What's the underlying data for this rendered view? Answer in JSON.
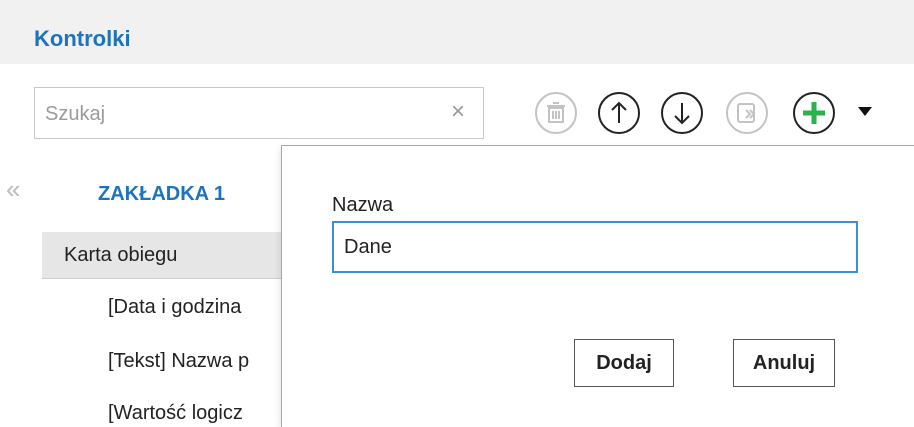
{
  "header": {
    "title": "Kontrolki"
  },
  "search": {
    "placeholder": "Szukaj",
    "value": "",
    "clear_glyph": "×"
  },
  "toolbar": {
    "icons": [
      "trash-icon",
      "arrow-up-icon",
      "arrow-down-icon",
      "move-to-icon",
      "plus-icon",
      "caret-down-icon"
    ],
    "colors": {
      "disabled": "#c3c3c3",
      "enabled": "#222222",
      "add": "#2bb24c"
    }
  },
  "left_panel": {
    "collapse_glyph": "«",
    "tab": "ZAKŁADKA 1",
    "section": "Karta obiegu",
    "items": [
      "[Data i godzina",
      "[Tekst] Nazwa p",
      "[Wartość logicz"
    ]
  },
  "dialog": {
    "field_label": "Nazwa",
    "field_value": "Dane",
    "add_button": "Dodaj",
    "cancel_button": "Anuluj",
    "accent": "#3a8fd6"
  }
}
